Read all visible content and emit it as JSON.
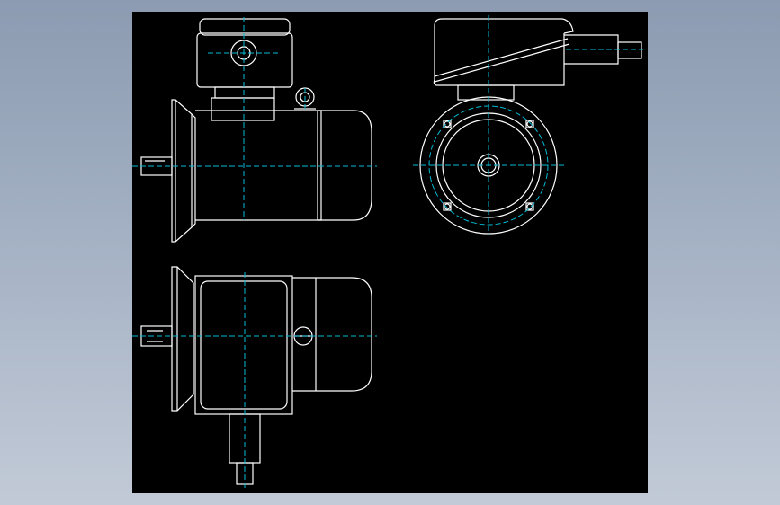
{
  "colors": {
    "background": "#000000",
    "outline": "#ffffff",
    "centerline": "#00bcd4"
  },
  "drawing": {
    "views": [
      "side-view",
      "front-view",
      "top-view"
    ]
  }
}
